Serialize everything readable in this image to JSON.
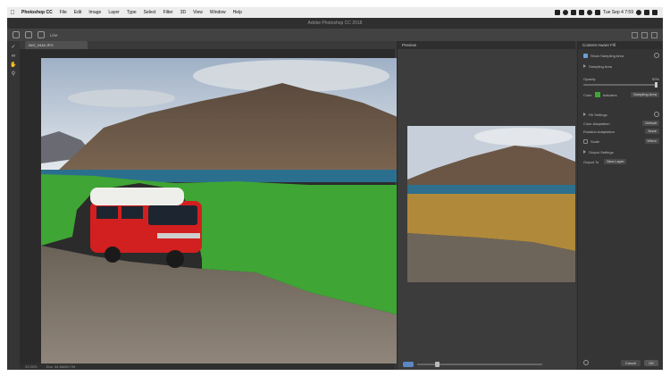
{
  "menubar": {
    "items": [
      "Photoshop CC",
      "File",
      "Edit",
      "Image",
      "Layer",
      "Type",
      "Select",
      "Filter",
      "3D",
      "View",
      "Window",
      "Help"
    ],
    "clock": "Tue Sep 4 7:59"
  },
  "window": {
    "title": "Adobe Photoshop CC 2018"
  },
  "options": {
    "mode_label": "Line"
  },
  "document": {
    "tab_label": "IMG_0448.JPG"
  },
  "status": {
    "zoom": "33.33%",
    "doc_size": "Doc: 34.8M/69.7M"
  },
  "preview": {
    "title": "Preview"
  },
  "settings": {
    "title": "Content-Aware Fill",
    "show_sampling_area": "Show Sampling Area",
    "sampling_section": "Sampling Area",
    "opacity_label": "Opacity",
    "opacity_value": "50%",
    "color_label": "Color",
    "indicates_label": "Indicates",
    "indicates_value": "Sampling Area",
    "fill_settings": "Fill Settings",
    "color_adaptation_label": "Color Adaptation",
    "color_adaptation_value": "Default",
    "rotation_adaptation_label": "Rotation Adaptation",
    "rotation_adaptation_value": "None",
    "scale_label": "Scale",
    "scale_value": "Mirror",
    "output_settings": "Output Settings",
    "output_to_label": "Output To",
    "output_to_value": "New Layer",
    "cancel_label": "Cancel",
    "ok_label": "OK"
  },
  "colors": {
    "sampling_overlay": "#3fa535",
    "van": "#d21f1f"
  }
}
